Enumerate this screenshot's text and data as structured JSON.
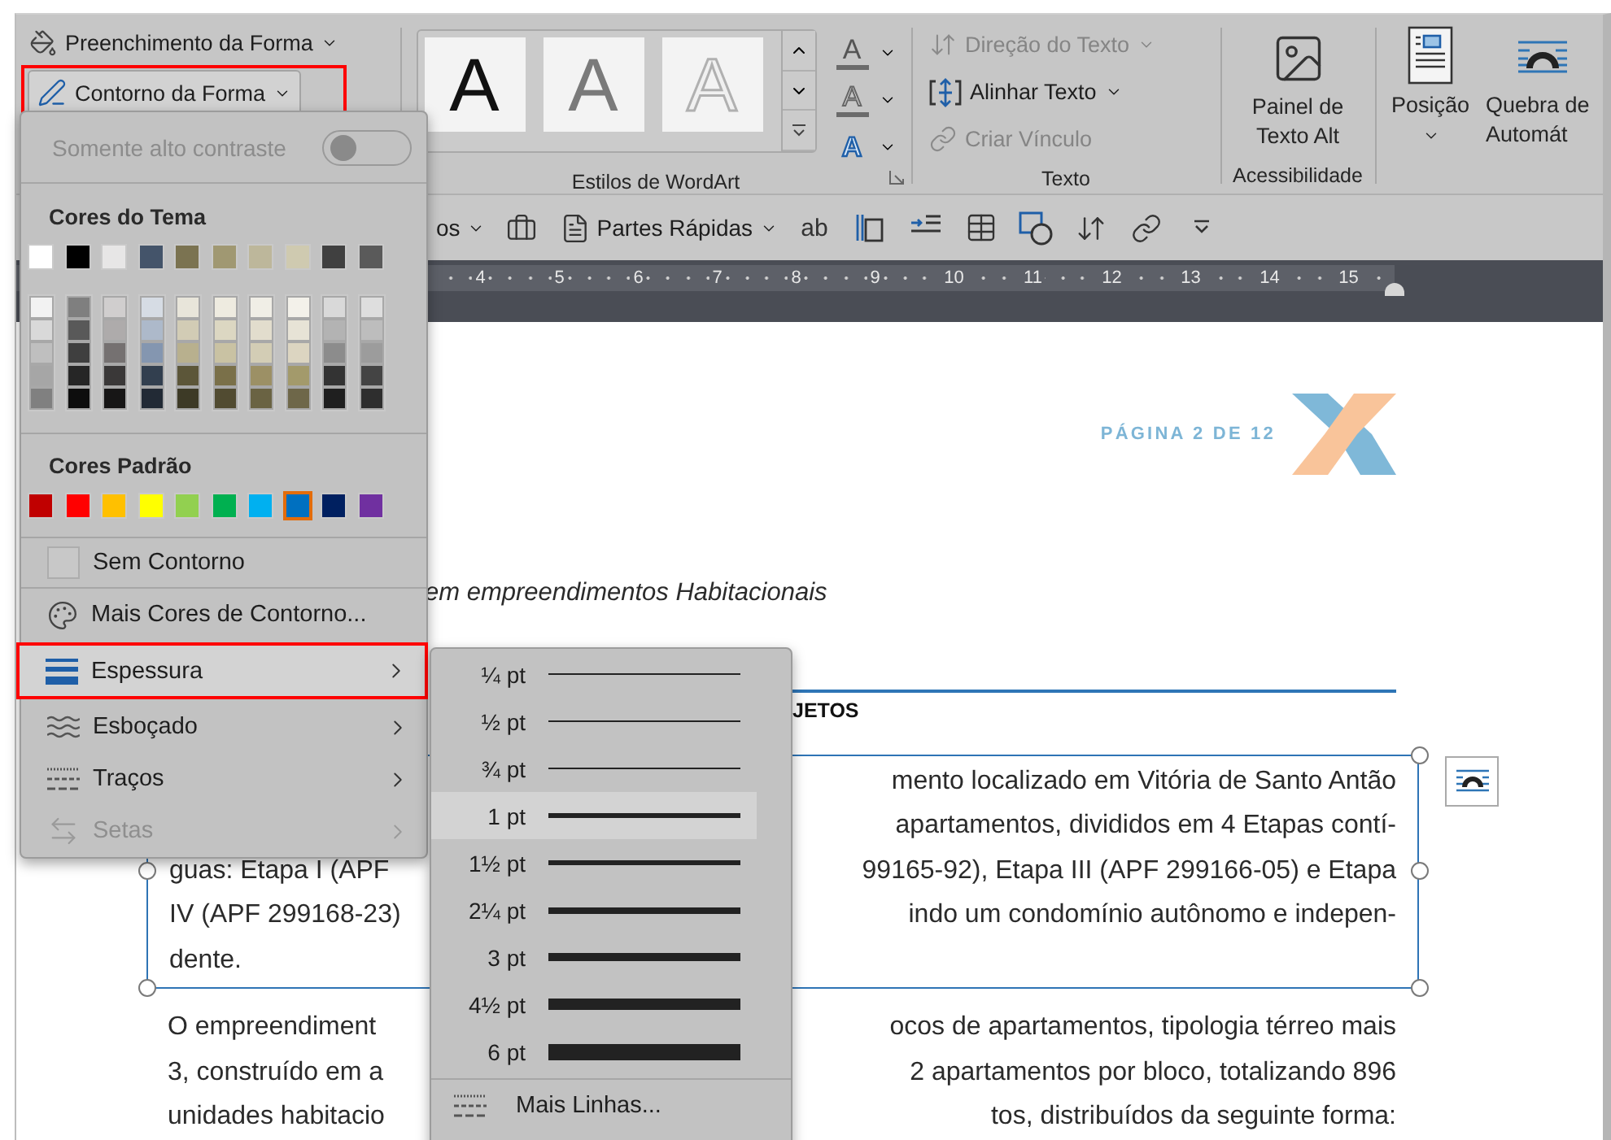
{
  "ribbon": {
    "shape_group": {
      "fill_button": {
        "label": "Preenchimento da Forma"
      },
      "outline_button": {
        "label": "Contorno da Forma",
        "pressed": true,
        "annotated": true
      }
    },
    "wordart": {
      "styles": [
        {
          "kind": "solid",
          "sample": "A"
        },
        {
          "kind": "gray",
          "sample": "A"
        },
        {
          "kind": "outline",
          "sample": "A"
        }
      ],
      "tools": [
        {
          "kind": "fill",
          "glyph": "A"
        },
        {
          "kind": "outline",
          "glyph": "A"
        },
        {
          "kind": "effects",
          "glyph": "A"
        }
      ],
      "label": "Estilos de WordArt"
    },
    "text_group": {
      "buttons": [
        {
          "kind": "direction",
          "label": "Direção do Texto",
          "disabled": true,
          "dropdown": true
        },
        {
          "kind": "align",
          "label": "Alinhar Texto",
          "disabled": false,
          "dropdown": true
        },
        {
          "kind": "link",
          "label": "Criar Vínculo",
          "disabled": true,
          "dropdown": false
        }
      ],
      "label": "Texto"
    },
    "accessibility": {
      "button": "Painel de Texto Alt",
      "label": "Acessibilidade"
    },
    "position": {
      "label": "Posição"
    },
    "wrap": {
      "label": "Quebra de Automát"
    }
  },
  "toolbar": [
    {
      "kind": "label",
      "label": "os"
    },
    {
      "kind": "toolbox"
    },
    {
      "kind": "quick-parts",
      "label": "Partes Rápidas"
    },
    {
      "kind": "glyph",
      "glyph": "ab"
    },
    {
      "kind": "textbox"
    },
    {
      "kind": "indent"
    },
    {
      "kind": "table"
    },
    {
      "kind": "shapes"
    },
    {
      "kind": "sort"
    },
    {
      "kind": "link"
    },
    {
      "kind": "overflow"
    }
  ],
  "ruler": {
    "numbers": [
      "4",
      "5",
      "6",
      "7",
      "8",
      "9",
      "10",
      "11",
      "12",
      "13",
      "14",
      "15"
    ]
  },
  "outline_menu": {
    "high_contrast": {
      "label": "Somente alto contraste",
      "disabled": true,
      "on": false
    },
    "theme_title": "Cores do Tema",
    "theme_colors": [
      {
        "color": "#ffffff",
        "selected": false
      },
      {
        "color": "#000000",
        "selected": false
      },
      {
        "color": "#e7e6e6",
        "selected": false
      },
      {
        "color": "#44546a",
        "selected": false
      },
      {
        "color": "#7b7351",
        "selected": false
      },
      {
        "color": "#a09872",
        "selected": false
      },
      {
        "color": "#bdb79b",
        "selected": false
      },
      {
        "color": "#cfcab0",
        "selected": false
      },
      {
        "color": "#404040",
        "selected": false
      },
      {
        "color": "#5a5a5a",
        "selected": false
      }
    ],
    "theme_shades": [
      {
        "shades": [
          {
            "color": "#f2f2f2",
            "selected": false
          },
          {
            "color": "#d9d9d9",
            "selected": false
          },
          {
            "color": "#bfbfbf",
            "selected": false
          },
          {
            "color": "#a6a6a6",
            "selected": false
          },
          {
            "color": "#808080",
            "selected": false
          }
        ]
      },
      {
        "shades": [
          {
            "color": "#7f7f7f",
            "selected": false
          },
          {
            "color": "#595959",
            "selected": false
          },
          {
            "color": "#3f3f3f",
            "selected": false
          },
          {
            "color": "#262626",
            "selected": false
          },
          {
            "color": "#0d0d0d",
            "selected": false
          }
        ]
      },
      {
        "shades": [
          {
            "color": "#d0cece",
            "selected": false
          },
          {
            "color": "#aeabab",
            "selected": false
          },
          {
            "color": "#757171",
            "selected": false
          },
          {
            "color": "#3a3838",
            "selected": false
          },
          {
            "color": "#171616",
            "selected": false
          }
        ]
      },
      {
        "shades": [
          {
            "color": "#d6dce4",
            "selected": false
          },
          {
            "color": "#adb9ca",
            "selected": false
          },
          {
            "color": "#8496b0",
            "selected": false
          },
          {
            "color": "#323f4f",
            "selected": false
          },
          {
            "color": "#222a35",
            "selected": false
          }
        ]
      },
      {
        "shades": [
          {
            "color": "#e8e5da",
            "selected": false
          },
          {
            "color": "#d2ccb5",
            "selected": false
          },
          {
            "color": "#b8b08e",
            "selected": false
          },
          {
            "color": "#5c5639",
            "selected": false
          },
          {
            "color": "#3d3a26",
            "selected": false
          }
        ]
      },
      {
        "shades": [
          {
            "color": "#eeebe0",
            "selected": false
          },
          {
            "color": "#dcd7c2",
            "selected": false
          },
          {
            "color": "#c9c2a3",
            "selected": false
          },
          {
            "color": "#7a7049",
            "selected": false
          },
          {
            "color": "#514b31",
            "selected": false
          }
        ]
      },
      {
        "shades": [
          {
            "color": "#f0eee6",
            "selected": false
          },
          {
            "color": "#e2ddcd",
            "selected": false
          },
          {
            "color": "#d3cdb5",
            "selected": false
          },
          {
            "color": "#9c9065",
            "selected": false
          },
          {
            "color": "#6a6343",
            "selected": false
          }
        ]
      },
      {
        "shades": [
          {
            "color": "#f3f1ea",
            "selected": false
          },
          {
            "color": "#e7e3d6",
            "selected": false
          },
          {
            "color": "#dcd5c1",
            "selected": false
          },
          {
            "color": "#a39a6b",
            "selected": false
          },
          {
            "color": "#6e6749",
            "selected": false
          }
        ]
      },
      {
        "shades": [
          {
            "color": "#d9d9d9",
            "selected": false
          },
          {
            "color": "#b3b3b3",
            "selected": false
          },
          {
            "color": "#8c8c8c",
            "selected": false
          },
          {
            "color": "#333333",
            "selected": false
          },
          {
            "color": "#1f1f1f",
            "selected": false
          }
        ]
      },
      {
        "shades": [
          {
            "color": "#dedede",
            "selected": false
          },
          {
            "color": "#bdbdbd",
            "selected": false
          },
          {
            "color": "#9c9c9c",
            "selected": false
          },
          {
            "color": "#444444",
            "selected": false
          },
          {
            "color": "#2e2e2e",
            "selected": false
          }
        ]
      }
    ],
    "standard_title": "Cores Padrão",
    "standard_colors": [
      {
        "color": "#c00000",
        "selected": false
      },
      {
        "color": "#ff0000",
        "selected": false
      },
      {
        "color": "#ffc000",
        "selected": false
      },
      {
        "color": "#ffff00",
        "selected": false
      },
      {
        "color": "#92d050",
        "selected": false
      },
      {
        "color": "#00b050",
        "selected": false
      },
      {
        "color": "#00b0f0",
        "selected": false
      },
      {
        "color": "#0070c0",
        "selected": true
      },
      {
        "color": "#002060",
        "selected": false
      },
      {
        "color": "#7030a0",
        "selected": false
      }
    ],
    "items": [
      {
        "kind": "no-outline",
        "label": "Sem Contorno",
        "submenu": false,
        "disabled": false,
        "selected": false,
        "annotated": false
      },
      {
        "kind": "more-colors",
        "label": "Mais Cores de Contorno...",
        "submenu": false,
        "disabled": false,
        "selected": false,
        "annotated": false
      },
      {
        "kind": "weight",
        "label": "Espessura",
        "submenu": true,
        "disabled": false,
        "selected": true,
        "annotated": true
      },
      {
        "kind": "sketch",
        "label": "Esboçado",
        "submenu": true,
        "disabled": false,
        "selected": false,
        "annotated": false
      },
      {
        "kind": "dashes",
        "label": "Traços",
        "submenu": true,
        "disabled": false,
        "selected": false,
        "annotated": false
      },
      {
        "kind": "arrows",
        "label": "Setas",
        "submenu": true,
        "disabled": true,
        "selected": false,
        "annotated": false
      }
    ]
  },
  "weight_menu": {
    "items": [
      {
        "label": "¼ pt",
        "selected": false
      },
      {
        "label": "½ pt",
        "selected": false
      },
      {
        "label": "¾ pt",
        "selected": false
      },
      {
        "label": "1 pt",
        "selected": true
      },
      {
        "label": "1½ pt",
        "selected": false
      },
      {
        "label": "2¼ pt",
        "selected": false
      },
      {
        "label": "3 pt",
        "selected": false
      },
      {
        "label": "4½ pt",
        "selected": false
      },
      {
        "label": "6 pt",
        "selected": false
      }
    ],
    "more": "Mais Linhas..."
  },
  "document": {
    "header": "PÁGINA 2 DE 12",
    "subtitle": "em empreendimentos Habitacionais",
    "heading": "JETOS",
    "text_box": {
      "selected": true,
      "lines": [
        {
          "right": "mento localizado em Vitória de Santo Antão"
        },
        {
          "right": "apartamentos, divididos em 4 Etapas contí-"
        },
        {
          "left": "guas: Etapa I (APF",
          "right": "99165-92), Etapa III (APF 299166-05) e Etapa"
        },
        {
          "left": "IV (APF 299168-23)",
          "right": "indo um condomínio autônomo e indepen-"
        },
        {
          "left": "dente."
        }
      ]
    },
    "paragraph": [
      {
        "left": "O empreendiment",
        "right": "ocos de apartamentos, tipologia térreo mais"
      },
      {
        "left": "3, construído em a",
        "right": "2 apartamentos por bloco, totalizando 896"
      },
      {
        "left": "unidades habitacio",
        "right": "tos, distribuídos da seguinte forma:"
      }
    ]
  }
}
